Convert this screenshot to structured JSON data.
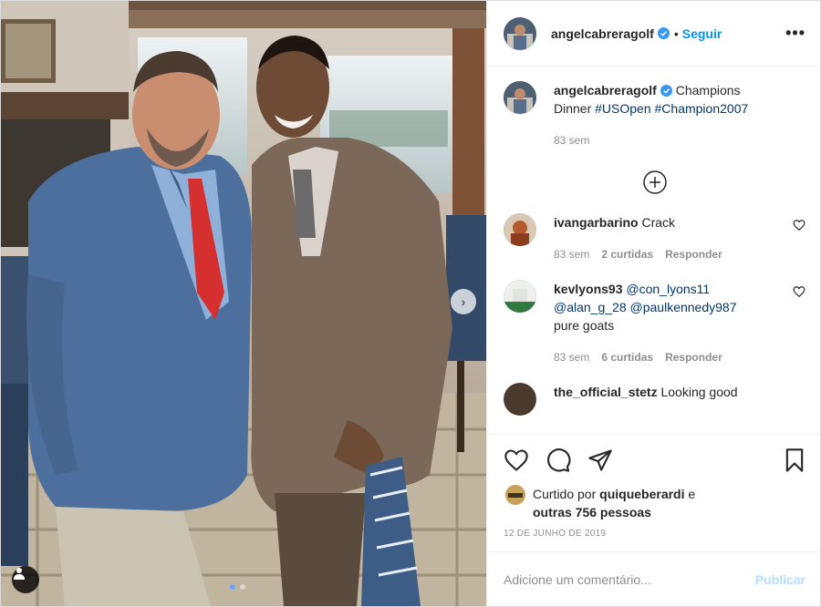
{
  "post": {
    "username": "angelcabreragolf",
    "follow_label": "Seguir",
    "more_label": "•••",
    "caption": {
      "text_plain": "Champions",
      "text_line2": "Dinner",
      "hashtags": [
        "#USOpen",
        "#Champion2007"
      ],
      "time": "83 sem"
    }
  },
  "comments": [
    {
      "username": "ivangarbarino",
      "text": "Crack",
      "time": "83 sem",
      "likes": "2 curtidas",
      "reply": "Responder"
    },
    {
      "username": "kevlyons93",
      "mentions": [
        "@con_lyons11",
        "@alan_g_28",
        "@paulkennedy987"
      ],
      "text": "pure goats",
      "time": "83 sem",
      "likes": "6 curtidas",
      "reply": "Responder"
    },
    {
      "username": "the_official_stetz",
      "text": "Looking good"
    }
  ],
  "engagement": {
    "liked_prefix": "Curtido por",
    "liked_user": "quiqueberardi",
    "liked_mid": "e",
    "liked_others": "outras 756 pessoas",
    "date": "12 DE JUNHO DE 2019"
  },
  "composer": {
    "placeholder": "Adicione um comentário...",
    "publish_label": "Publicar"
  },
  "photo": {
    "nav_glyph": "›",
    "carousel_total": 2,
    "carousel_active": 1
  },
  "colors": {
    "accent": "#0095f6",
    "verified": "#3897f0",
    "publish_disabled": "#b2dffc",
    "meta_gray": "#8e8e8e",
    "link": "#00376b"
  },
  "icons": [
    "heart-icon",
    "comment-icon",
    "share-icon",
    "bookmark-icon",
    "plus-circle-icon",
    "verified-badge-icon",
    "user-tag-icon",
    "chevron-right-icon"
  ]
}
